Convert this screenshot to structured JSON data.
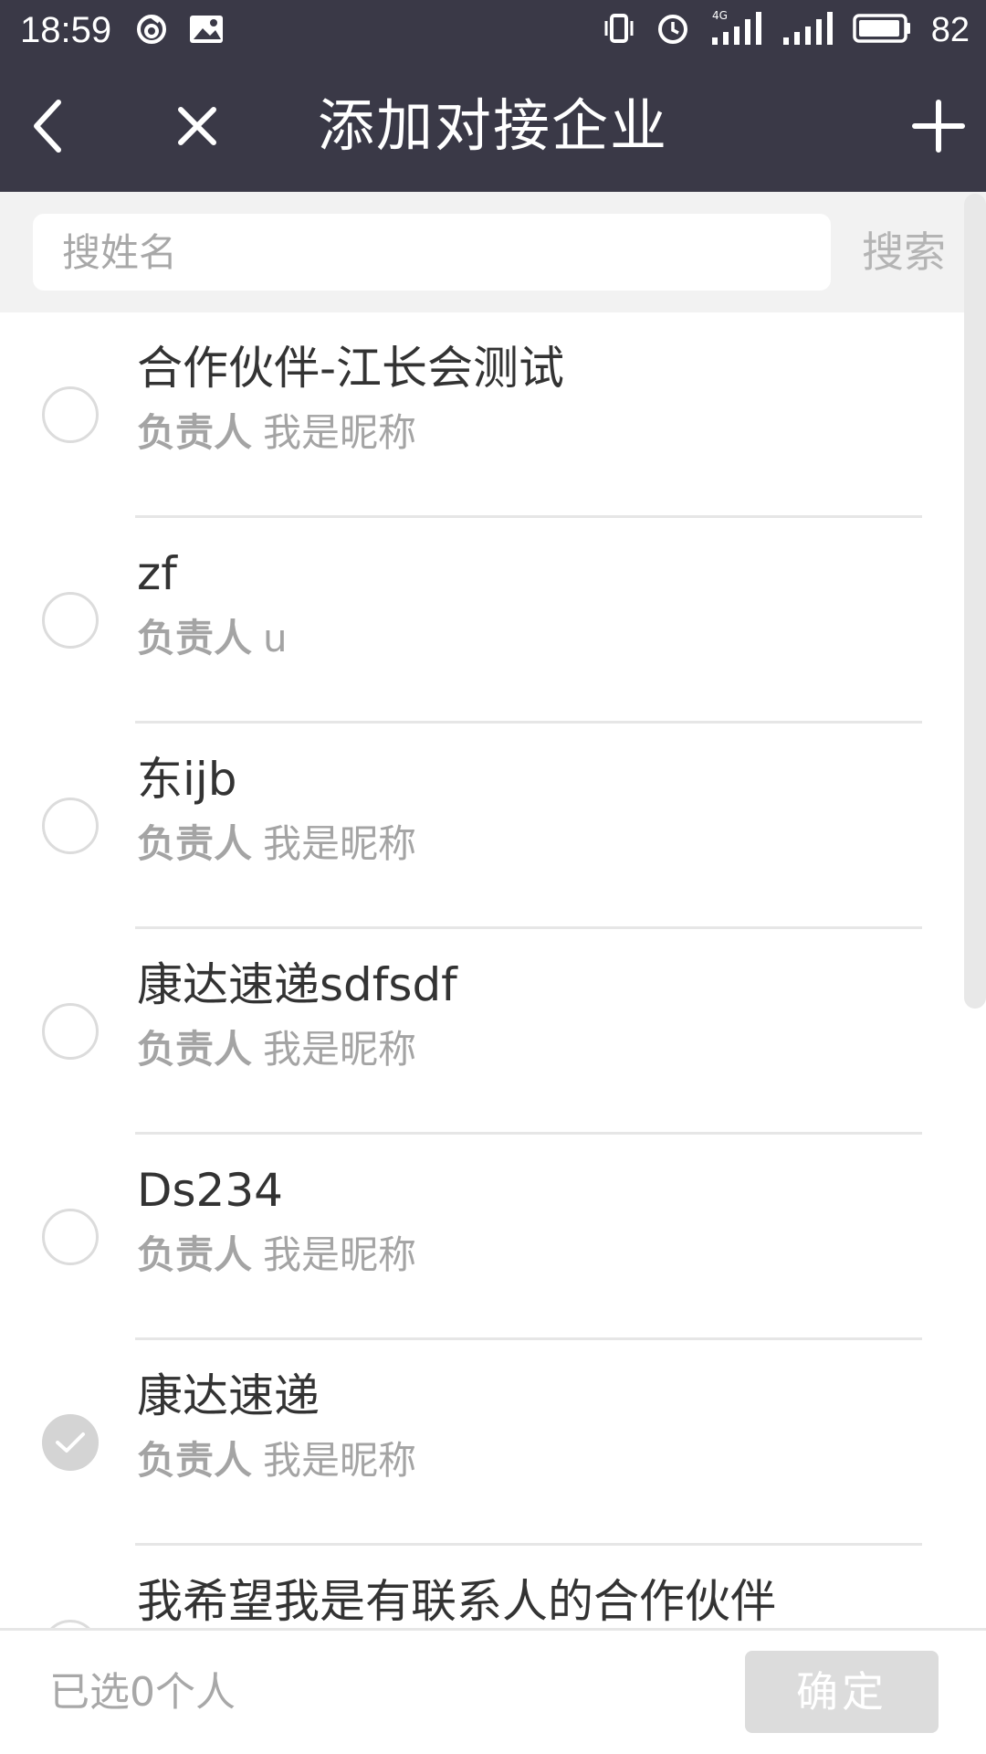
{
  "status_bar": {
    "time": "18:59",
    "battery_percent": "82",
    "network_type": "4G",
    "left_icons": [
      "sync-icon",
      "image-icon"
    ],
    "right_icons": [
      "vibrate-icon",
      "alarm-icon",
      "signal-4g-icon",
      "signal-icon",
      "battery-icon"
    ]
  },
  "header": {
    "title": "添加对接企业",
    "back_icon": "chevron-left-icon",
    "close_icon": "close-icon",
    "add_icon": "plus-icon"
  },
  "search": {
    "placeholder": "搜姓名",
    "value": "",
    "button_label": "搜索"
  },
  "list": {
    "items": [
      {
        "name": "合作伙伴-江长会测试",
        "sub_label": "负责人",
        "sub_value": "我是昵称",
        "checked": false
      },
      {
        "name": "zf",
        "sub_label": "负责人",
        "sub_value": "u",
        "checked": false
      },
      {
        "name": "东ijb",
        "sub_label": "负责人",
        "sub_value": "我是昵称",
        "checked": false
      },
      {
        "name": "康达速递sdfsdf",
        "sub_label": "负责人",
        "sub_value": "我是昵称",
        "checked": false
      },
      {
        "name": "Ds234",
        "sub_label": "负责人",
        "sub_value": "我是昵称",
        "checked": false
      },
      {
        "name": "康达速递",
        "sub_label": "负责人",
        "sub_value": "我是昵称",
        "checked": true
      },
      {
        "name": "我希望我是有联系人的合作伙伴",
        "sub_label": "",
        "sub_value": "",
        "checked": false
      }
    ]
  },
  "footer": {
    "selected_text": "已选0个人",
    "confirm_label": "确定"
  },
  "colors": {
    "header_bg": "#3a3947",
    "search_area_bg": "#f2f2f2",
    "muted_text": "#a4a4a4",
    "confirm_disabled_bg": "#dcdcdc"
  }
}
